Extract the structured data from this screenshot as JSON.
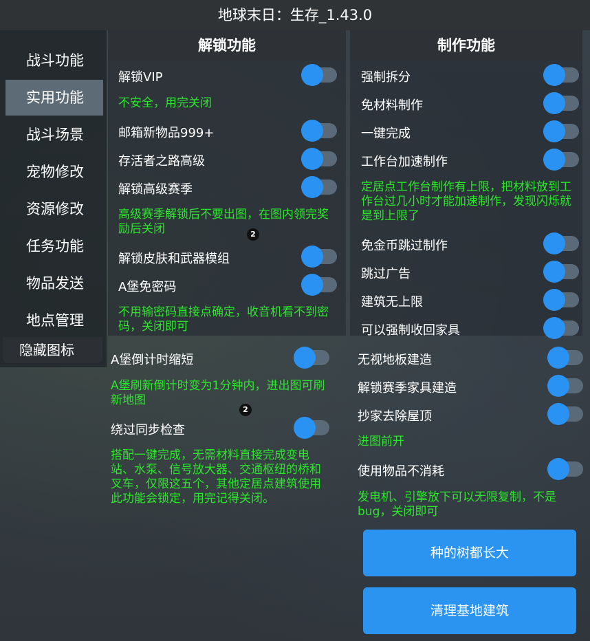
{
  "window": {
    "title": "地球末日：生存_1.43.0"
  },
  "nav": {
    "items": [
      "战斗功能",
      "实用功能",
      "战斗场景",
      "宠物修改",
      "资源修改",
      "任务功能",
      "物品发送",
      "地点管理"
    ],
    "active": "实用功能",
    "hide_icons": "隐藏图标"
  },
  "unlock": {
    "header": "解锁功能",
    "vip": "解锁VIP",
    "vip_note": "不安全，用完关闭",
    "mail999": "邮箱新物品999+",
    "survivor_road": "存活者之路高级",
    "season": "解锁高级赛季",
    "season_note": "高级赛季解锁后不要出图，在图内领完奖励后关闭",
    "badge1": "2",
    "skin": "解锁皮肤和武器模组",
    "bunker_pwd": "A堡免密码",
    "bunker_pwd_note": "不用输密码直接点确定，收音机看不到密码，关闭即可",
    "bunker_timer": "A堡倒计时缩短",
    "bunker_timer_note": "A堡刷新倒计时变为1分钟内，进出图可刷新地图",
    "badge2": "2",
    "sync": "绕过同步检查",
    "sync_note": "搭配一键完成，无需材料直接完成变电站、水泵、信号放大器、交通枢纽的桥和叉车，仅限这五个，其他定居点建筑使用此功能会锁定，用完记得关闭。"
  },
  "craft": {
    "header": "制作功能",
    "force_dismantle": "强制拆分",
    "free_material": "免材料制作",
    "one_click": "一键完成",
    "bench_speed": "工作台加速制作",
    "bench_note": "定居点工作台制作有上限，把材料放到工作台过几小时才能加速制作，发现闪烁就是到上限了",
    "skip_coin": "免金币跳过制作",
    "skip_ad": "跳过广告",
    "no_build_limit": "建筑无上限",
    "force_recall": "可以强制收回家具",
    "ignore_floor": "无视地板建造",
    "season_furniture": "解锁赛季家具建造",
    "raid_roof": "抄家去除屋顶",
    "raid_note": "进图前开",
    "no_consume": "使用物品不消耗",
    "no_consume_note": "发电机、引擎放下可以无限复制，不是bug，关闭即可",
    "btn_trees": "种的树都长大",
    "btn_clear": "清理基地建筑"
  },
  "colors": {
    "accent": "#2a92f2",
    "note_green": "#2ce62c",
    "track": "#5a6a78"
  }
}
